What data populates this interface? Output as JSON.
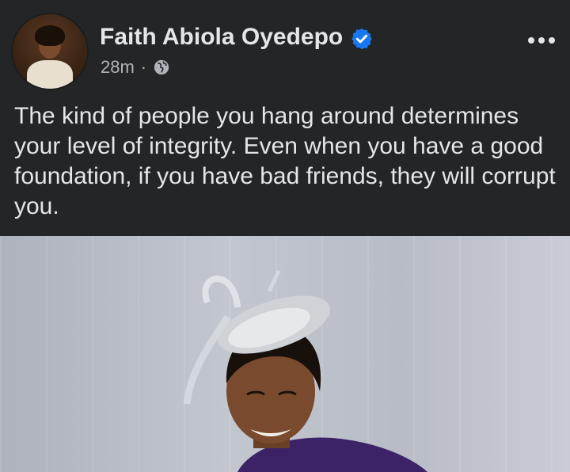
{
  "post": {
    "author": "Faith Abiola Oyedepo",
    "time": "28m",
    "separator": "·",
    "visibility_icon": "globe-icon",
    "verified_icon": "verified-badge-icon",
    "text": "The kind of people you hang around determines your level of integrity. Even when you have a good foundation, if you have bad friends, they will corrupt you."
  },
  "colors": {
    "background": "#242526",
    "text": "#e4e6eb",
    "secondary_text": "#b0b3b8",
    "verified": "#1877f2"
  }
}
